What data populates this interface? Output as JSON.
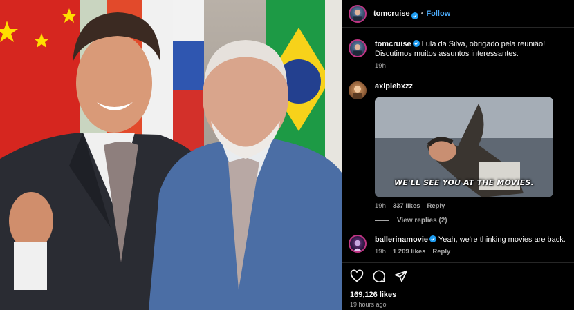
{
  "post": {
    "author": "tomcruise",
    "follow_label": "Follow",
    "separator": "•",
    "caption_author": "tomcruise",
    "caption_text": "Lula da Silva, obrigado pela reunião! Discutimos muitos assuntos interessantes.",
    "caption_time": "19h"
  },
  "comments": [
    {
      "username": "axlpiebxzz",
      "time": "19h",
      "likes": "337 likes",
      "reply_label": "Reply",
      "gif_caption": "WE'LL SEE YOU AT THE MOVIES."
    },
    {
      "username": "ballerinamovie",
      "text": "Yeah, we're thinking movies are back.",
      "time": "19h",
      "likes": "1 209 likes",
      "reply_label": "Reply"
    }
  ],
  "view_replies": "View replies (2)",
  "footer": {
    "likes": "169,126 likes",
    "time_ago": "19 hours ago"
  },
  "icons": [
    "heart-icon",
    "comment-icon",
    "share-icon",
    "verified-badge-icon"
  ],
  "colors": {
    "accent": "#4aa8f5",
    "verified": "#1d9bf0",
    "background": "#000000",
    "muted": "#a8a8a8"
  }
}
